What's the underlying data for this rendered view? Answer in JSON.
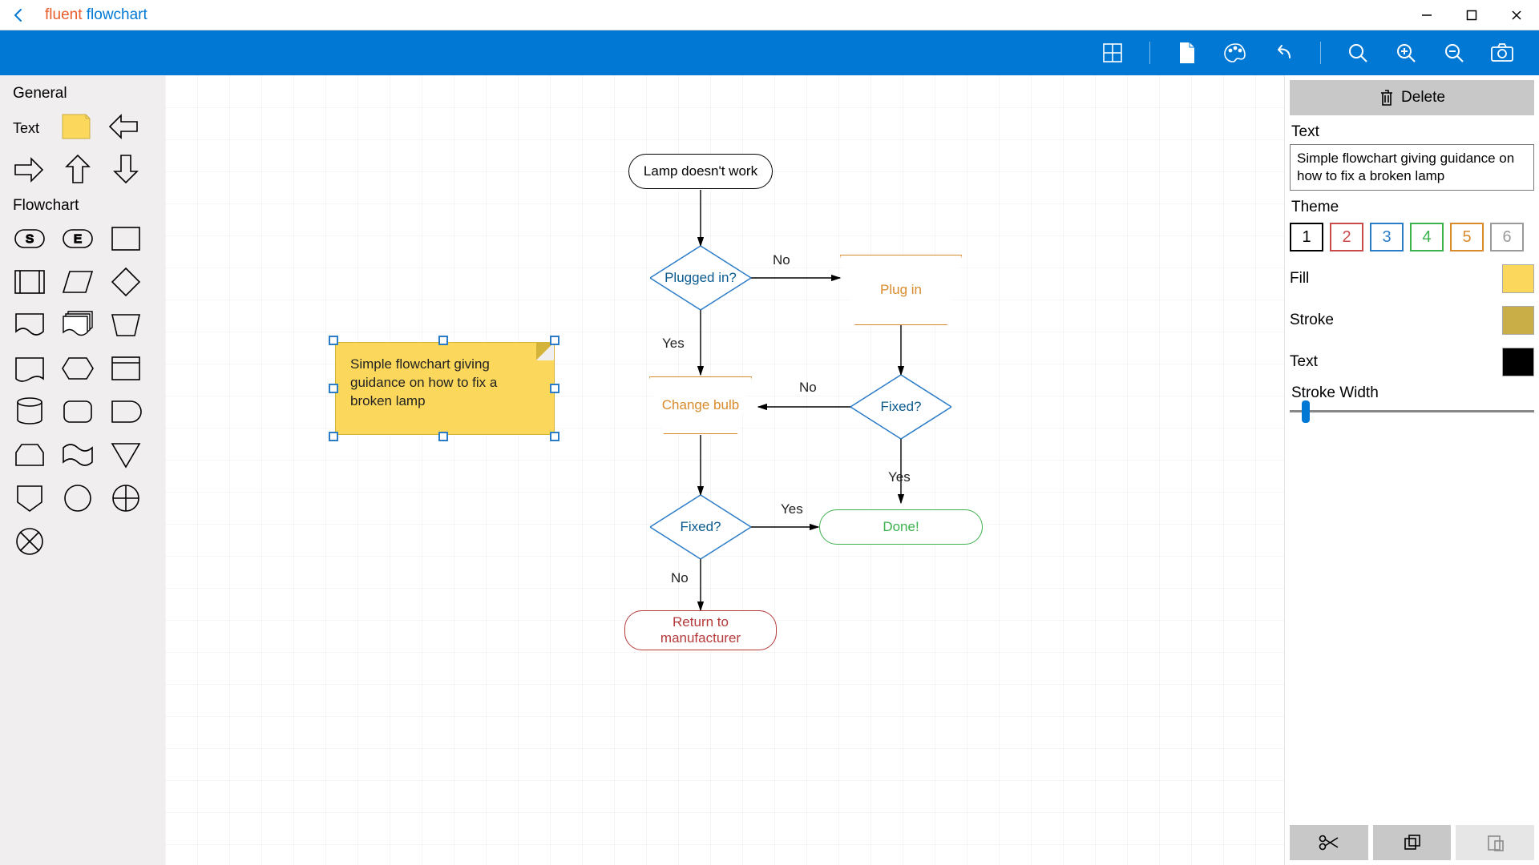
{
  "app": {
    "title_accent": "fluent",
    "title_rest": " flowchart"
  },
  "palette": {
    "section_general": "General",
    "section_flowchart": "Flowchart",
    "label_text": "Text",
    "start_letter": "S",
    "end_letter": "E"
  },
  "note": {
    "text": "Simple flowchart giving guidance on how to fix a broken lamp"
  },
  "flow": {
    "n_start": "Lamp doesn't work",
    "n_plugged": "Plugged in?",
    "n_plugin": "Plug in",
    "n_fixed1": "Fixed?",
    "n_change": "Change bulb",
    "n_fixed2": "Fixed?",
    "n_done": "Done!",
    "n_return": "Return to manufacturer",
    "lbl_no1": "No",
    "lbl_yes1": "Yes",
    "lbl_no2": "No",
    "lbl_yes2": "Yes",
    "lbl_yes3": "Yes",
    "lbl_no3": "No"
  },
  "props": {
    "delete_label": "Delete",
    "text_label": "Text",
    "text_value": "Simple flowchart giving guidance on how to fix a broken lamp",
    "theme_label": "Theme",
    "themes": [
      {
        "n": "1",
        "color": "#000000"
      },
      {
        "n": "2",
        "color": "#c94a4a"
      },
      {
        "n": "3",
        "color": "#2b7cc7"
      },
      {
        "n": "4",
        "color": "#3bb24c"
      },
      {
        "n": "5",
        "color": "#d98a2b"
      },
      {
        "n": "6",
        "color": "#9a9a9a"
      }
    ],
    "fill_label": "Fill",
    "fill_color": "#fbd85b",
    "stroke_label": "Stroke",
    "stroke_color": "#c9ad47",
    "textcolor_label": "Text",
    "text_color": "#000000",
    "strokewidth_label": "Stroke Width",
    "strokewidth_value": 5
  }
}
